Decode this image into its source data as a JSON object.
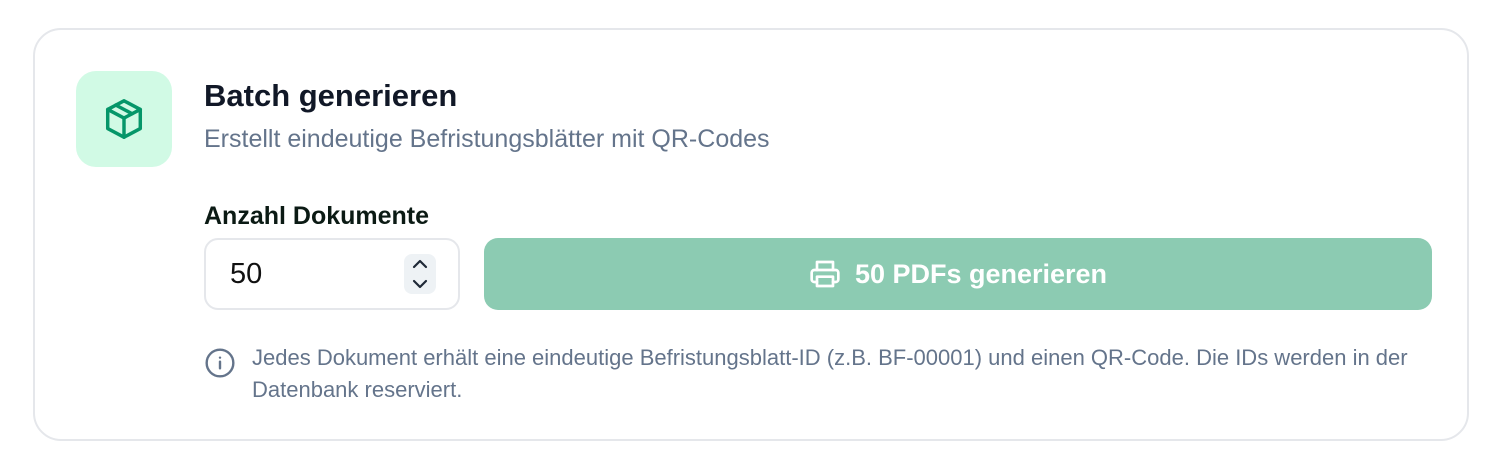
{
  "batch_card": {
    "icon": "package-icon",
    "title": "Batch generieren",
    "subtitle": "Erstellt eindeutige Befristungsblätter mit QR-Codes",
    "quantity": {
      "label": "Anzahl Dokumente",
      "value": "50"
    },
    "generate_button": {
      "icon": "printer-icon",
      "label": "50 PDFs generieren"
    },
    "info": {
      "icon": "info-icon",
      "text": "Jedes Dokument erhält eine eindeutige Befristungsblatt-ID (z.B. BF-00001) und einen QR-Code. Die IDs werden in der Datenbank reserviert."
    }
  },
  "colors": {
    "accent": "#059669",
    "icon_tile_bg": "#d1fae5",
    "button_bg": "#8ccbb2",
    "muted_text": "#64748b",
    "title_text": "#111827",
    "border": "#e5e7eb"
  }
}
